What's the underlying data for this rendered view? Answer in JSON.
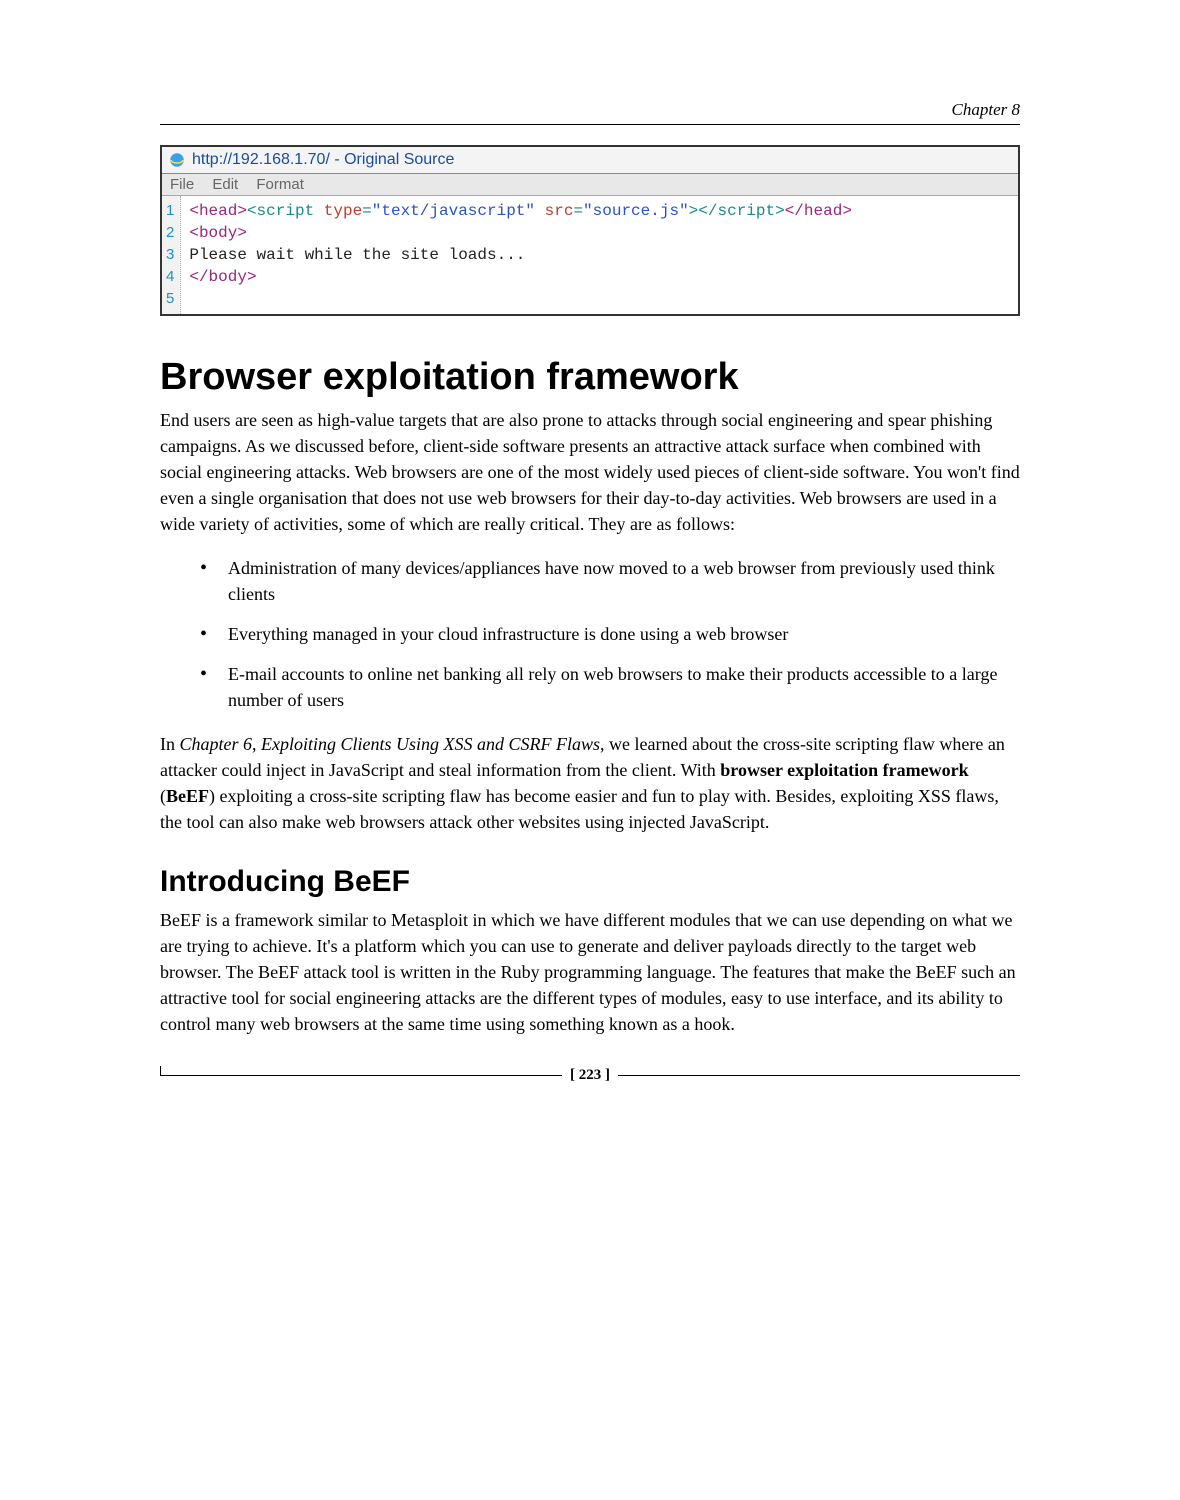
{
  "chapter": "Chapter 8",
  "codeWindow": {
    "title": "http://192.168.1.70/ - Original Source",
    "menu": [
      "File",
      "Edit",
      "Format"
    ],
    "lineNumbers": [
      "1",
      "2",
      "3",
      "4",
      "5"
    ],
    "lines": {
      "l1": {
        "t1": "<head>",
        "t2": "<script ",
        "a1": "type",
        "eq1": "=",
        "v1": "\"text/javascript\"",
        "sp": " ",
        "a2": "src",
        "eq2": "=",
        "v2": "\"source.js\"",
        "t3": ">",
        "t4": "</script>",
        "t5": "</head>"
      },
      "l2": "<body>",
      "l3": "Please wait while the site loads...",
      "l4": "</body>"
    }
  },
  "h1": "Browser exploitation framework",
  "p1": "End users are seen as high-value targets that are also prone to attacks through social engineering and spear phishing campaigns. As we discussed before, client-side software presents an attractive attack surface when combined with social engineering attacks. Web browsers are one of the most widely used pieces of client-side software. You won't find even a single organisation that does not use web browsers for their day-to-day activities. Web browsers are used in a wide variety of activities, some of which are really critical. They are as follows:",
  "bullets": [
    "Administration of many devices/appliances have now moved to a web browser from previously used think clients",
    "Everything managed in your cloud infrastructure is done using a web browser",
    "E-mail accounts to online net banking all rely on web browsers to make their products accessible to a large number of users"
  ],
  "p2": {
    "pre": "In ",
    "ital1": "Chapter 6",
    "comma": ", ",
    "ital2": "Exploiting Clients Using XSS and CSRF Flaws",
    "mid1": ", we learned about the cross-site scripting flaw where an attacker could inject in JavaScript and steal information from the client. With ",
    "bold1": "browser exploitation framework",
    "mid2": " (",
    "bold2": "BeEF",
    "mid3": ") exploiting a cross-site scripting flaw has become easier and fun to play with. Besides, exploiting XSS flaws, the tool can also make web browsers attack other websites using injected JavaScript."
  },
  "h2": "Introducing BeEF",
  "p3": "BeEF is a framework similar to Metasploit in which we have different modules that we can use depending on what we are trying to achieve. It's a platform which you can use to generate and deliver payloads directly to the target web browser. The BeEF attack tool is written in the Ruby programming language. The features that make the BeEF such an attractive tool for social engineering attacks are the different types of modules, easy to use interface, and its ability to control many web browsers at the same time using something known as a hook.",
  "pageNum": "[ 223 ]"
}
